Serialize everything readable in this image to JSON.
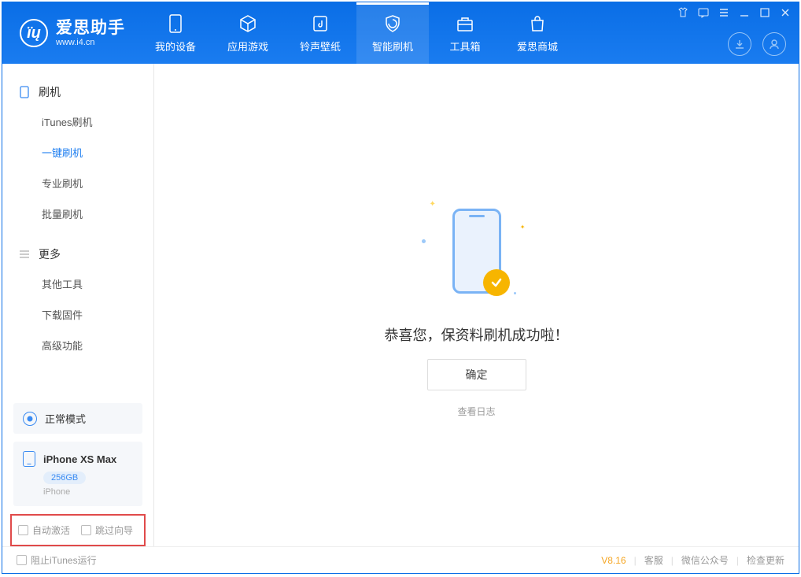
{
  "app": {
    "title": "爱思助手",
    "subtitle": "www.i4.cn"
  },
  "nav": [
    {
      "id": "my-device",
      "label": "我的设备"
    },
    {
      "id": "apps-games",
      "label": "应用游戏"
    },
    {
      "id": "ringtones-wallpapers",
      "label": "铃声壁纸"
    },
    {
      "id": "smart-flash",
      "label": "智能刷机"
    },
    {
      "id": "toolbox",
      "label": "工具箱"
    },
    {
      "id": "store",
      "label": "爱思商城"
    }
  ],
  "sidebar": {
    "group1": {
      "title": "刷机",
      "items": [
        {
          "id": "itunes-flash",
          "label": "iTunes刷机"
        },
        {
          "id": "one-click-flash",
          "label": "一键刷机"
        },
        {
          "id": "pro-flash",
          "label": "专业刷机"
        },
        {
          "id": "batch-flash",
          "label": "批量刷机"
        }
      ]
    },
    "group2": {
      "title": "更多",
      "items": [
        {
          "id": "other-tools",
          "label": "其他工具"
        },
        {
          "id": "download-firmware",
          "label": "下载固件"
        },
        {
          "id": "advanced",
          "label": "高级功能"
        }
      ]
    },
    "status": "正常模式",
    "device": {
      "name": "iPhone XS Max",
      "capacity": "256GB",
      "type": "iPhone"
    },
    "opts": {
      "auto_activate": "自动激活",
      "skip_wizard": "跳过向导"
    }
  },
  "main": {
    "success_text": "恭喜您，保资料刷机成功啦！",
    "ok_label": "确定",
    "log_label": "查看日志"
  },
  "footer": {
    "block_itunes": "阻止iTunes运行",
    "version": "V8.16",
    "links": {
      "cs": "客服",
      "wechat": "微信公众号",
      "update": "检查更新"
    }
  }
}
